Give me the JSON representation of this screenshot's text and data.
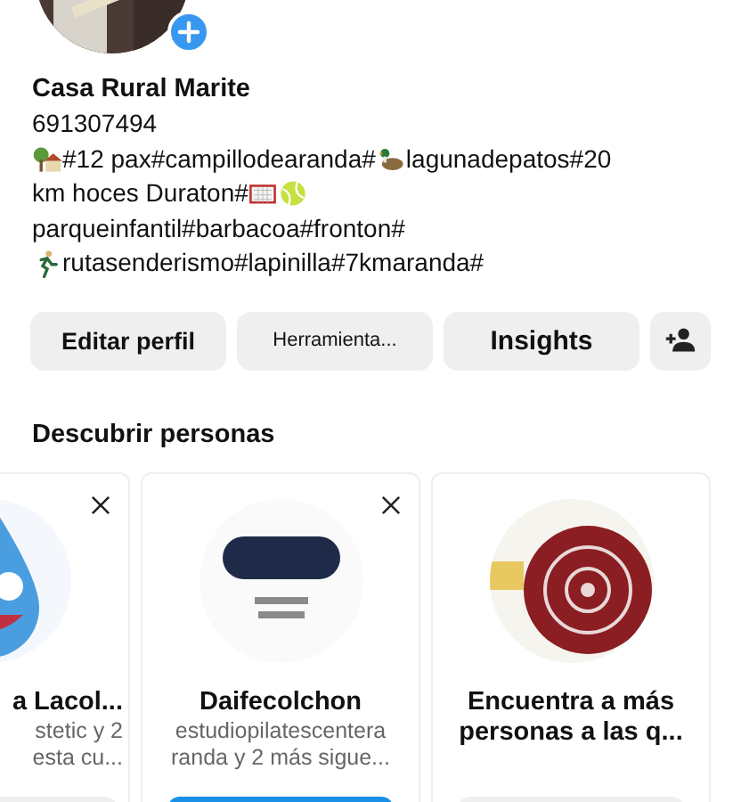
{
  "profile": {
    "name": "Casa Rural Marite",
    "phone": "691307494",
    "bio_lines": [
      [
        {
          "kind": "icon"
        },
        {
          "kind": "text",
          "text": "#12 pax#campillodearanda#"
        },
        {
          "kind": "icon"
        },
        {
          "kind": "text",
          "text": " lagunadepatos#20"
        }
      ],
      [
        {
          "kind": "text",
          "text": "km hoces Duraton#"
        },
        {
          "kind": "icon"
        },
        {
          "kind": "icon"
        }
      ],
      [
        {
          "kind": "text",
          "text": "parqueinfantil#barbacoa#fronton#"
        }
      ],
      [
        {
          "kind": "icon"
        },
        {
          "kind": "text",
          "text": " rutasenderismo#lapinilla#7kmaranda#"
        }
      ]
    ]
  },
  "buttons": [
    {
      "label": "Editar perfil"
    },
    {
      "label": "Herramienta..."
    },
    {
      "label": "Insights"
    }
  ],
  "discover": {
    "title": "Descubrir personas",
    "cards": [
      {
        "name": "a Lacol...",
        "subtitle": [
          "stetic y 2",
          "esta cu..."
        ],
        "dismissable": true,
        "primary": false,
        "partial": true
      },
      {
        "name": "Daifecolchon",
        "subtitle": [
          "estudiopilatescentera",
          "randa y 2 más sigue..."
        ],
        "dismissable": true,
        "primary": true,
        "partial": false
      },
      {
        "name": "Encuentra a más personas a las q...",
        "dismissable": false,
        "primary": false,
        "partial": false
      }
    ]
  }
}
